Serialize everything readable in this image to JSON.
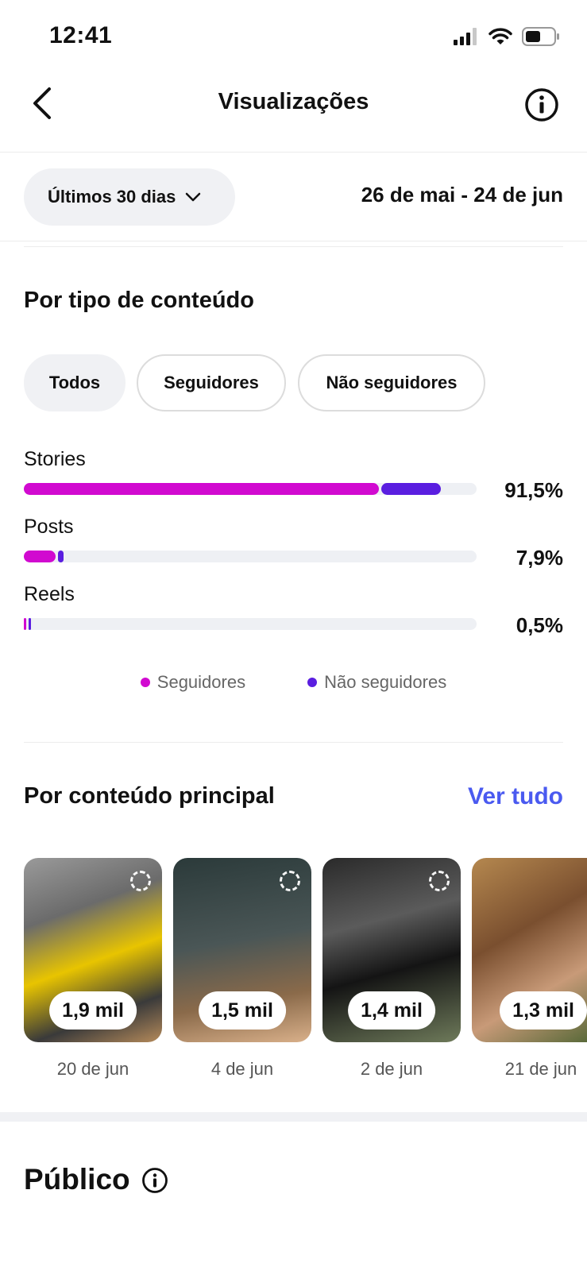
{
  "status_bar": {
    "time": "12:41"
  },
  "header": {
    "title": "Visualizações"
  },
  "range": {
    "selector_label": "Últimos 30 dias",
    "dates": "26 de mai - 24 de jun"
  },
  "by_content_type": {
    "title": "Por tipo de conteúdo",
    "filters": [
      "Todos",
      "Seguidores",
      "Não seguidores"
    ],
    "active_filter": "Todos",
    "rows": [
      {
        "label": "Stories",
        "percent": "91,5%",
        "followers_fraction": 0.785,
        "non_followers_fraction": 0.13
      },
      {
        "label": "Posts",
        "percent": "7,9%",
        "followers_fraction": 0.07,
        "non_followers_fraction": 0.012
      },
      {
        "label": "Reels",
        "percent": "0,5%",
        "followers_fraction": 0.003,
        "non_followers_fraction": 0.004
      }
    ],
    "legend": {
      "followers": "Seguidores",
      "non_followers": "Não seguidores"
    }
  },
  "colors": {
    "followers": "#d10ad0",
    "non_followers": "#5a1ee0",
    "link": "#4a5af0"
  },
  "top_content": {
    "title": "Por conteúdo principal",
    "see_all": "Ver tudo",
    "items": [
      {
        "views": "1,9 mil",
        "date": "20 de jun"
      },
      {
        "views": "1,5 mil",
        "date": "4 de jun"
      },
      {
        "views": "1,4 mil",
        "date": "2 de jun"
      },
      {
        "views": "1,3 mil",
        "date": "21 de jun"
      }
    ]
  },
  "audience": {
    "title": "Público"
  }
}
